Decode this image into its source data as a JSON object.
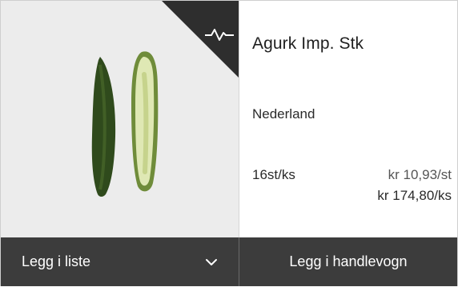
{
  "product": {
    "name": "Agurk Imp. Stk",
    "origin": "Nederland",
    "pack_size": "16st/ks",
    "price_unit": "kr 10,93/st",
    "price_pack": "kr 174,80/ks",
    "image_icon": "cucumber-image",
    "badge_icon": "pulse-icon"
  },
  "actions": {
    "list_label": "Legg i liste",
    "list_icon": "chevron-down-icon",
    "cart_label": "Legg i handlevogn"
  },
  "colors": {
    "bar_background": "#3c3c3c",
    "badge": "#2e2e2e",
    "image_background": "#ececec"
  }
}
